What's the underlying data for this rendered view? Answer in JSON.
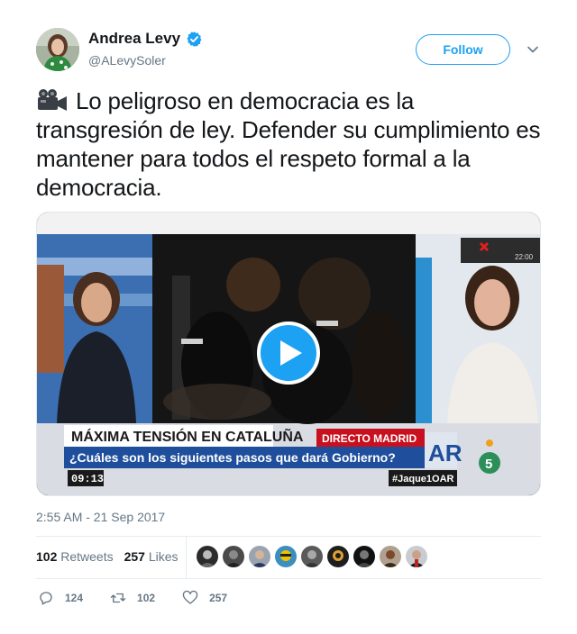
{
  "author": {
    "display_name": "Andrea Levy",
    "handle": "@ALevySoler",
    "verified": true,
    "avatar_icon": "profile-photo"
  },
  "follow_label": "Follow",
  "tweet": {
    "emoji_icon": "movie-camera-icon",
    "text": "Lo peligroso en democracia es la transgresión de ley. Defender su cumplimiento es mantener para todos el respeto formal a la democracia."
  },
  "video": {
    "headline": "MÁXIMA TENSIÓN EN CATALUÑA",
    "live_label": "DIRECTO MADRID",
    "question": "¿Cuáles son los siguientes pasos que dará Gobierno?",
    "time": "09:13",
    "hashtag": "#Jaque1OAR",
    "show_logo": "AR",
    "channel_number": "5",
    "corner_label": "22:00"
  },
  "timestamp": "2:55 AM - 21 Sep 2017",
  "stats": {
    "retweets_count": "102",
    "retweets_label": "Retweets",
    "likes_count": "257",
    "likes_label": "Likes"
  },
  "actions": {
    "reply_count": "124",
    "retweet_count": "102",
    "like_count": "257"
  },
  "colors": {
    "accent": "#1da1f2",
    "muted": "#657786",
    "text": "#14171a"
  }
}
